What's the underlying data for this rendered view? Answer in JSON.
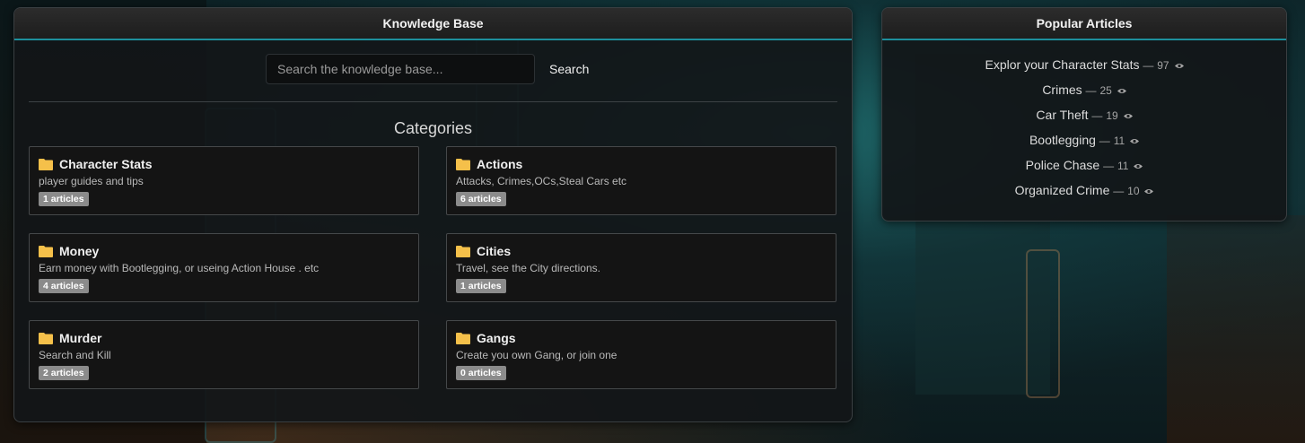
{
  "knowledge_base": {
    "title": "Knowledge Base",
    "search": {
      "placeholder": "Search the knowledge base...",
      "value": "",
      "button_label": "Search"
    },
    "categories_heading": "Categories",
    "categories": [
      {
        "name": "Character Stats",
        "description": "player guides and tips",
        "badge": "1 articles"
      },
      {
        "name": "Actions",
        "description": "Attacks, Crimes,OCs,Steal Cars etc",
        "badge": "6 articles"
      },
      {
        "name": "Money",
        "description": "Earn money with Bootlegging, or useing Action House . etc",
        "badge": "4 articles"
      },
      {
        "name": "Cities",
        "description": "Travel, see the City directions.",
        "badge": "1 articles"
      },
      {
        "name": "Murder",
        "description": "Search and Kill",
        "badge": "2 articles"
      },
      {
        "name": "Gangs",
        "description": "Create you own Gang, or join one",
        "badge": "0 articles"
      }
    ]
  },
  "popular": {
    "title": "Popular Articles",
    "separator": "—",
    "items": [
      {
        "title": "Explor your Character Stats",
        "views": "97"
      },
      {
        "title": "Crimes",
        "views": "25"
      },
      {
        "title": "Car Theft",
        "views": "19"
      },
      {
        "title": "Bootlegging",
        "views": "11"
      },
      {
        "title": "Police Chase",
        "views": "11"
      },
      {
        "title": "Organized Crime",
        "views": "10"
      }
    ]
  },
  "icons": {
    "category": "folder-icon",
    "views": "eye-icon"
  },
  "colors": {
    "accent": "#1d8f9c",
    "folder": "#f5c04a",
    "badge": "#8b8b8b"
  }
}
